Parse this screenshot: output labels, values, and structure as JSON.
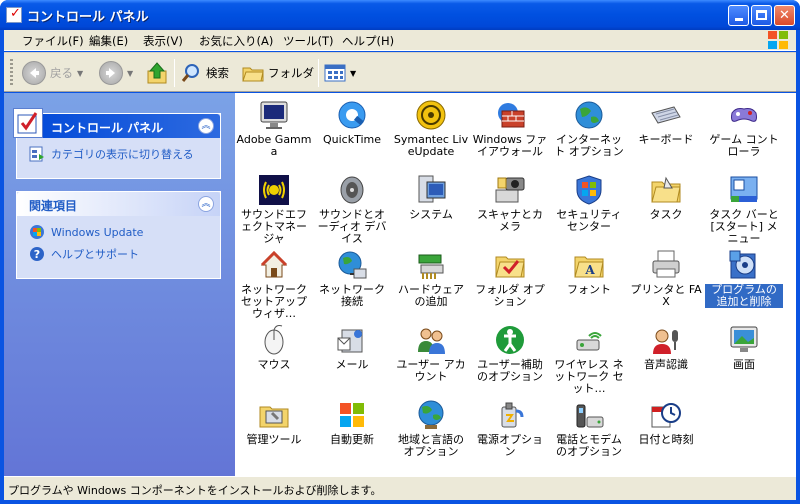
{
  "window": {
    "title": "コントロール パネル"
  },
  "menu": [
    "ファイル(F)",
    "編集(E)",
    "表示(V)",
    "お気に入り(A)",
    "ツール(T)",
    "ヘルプ(H)"
  ],
  "toolbar": {
    "back": "戻る",
    "search": "検索",
    "folders": "フォルダ"
  },
  "left": {
    "main_title": "コントロール パネル",
    "switch_view": "カテゴリの表示に切り替える",
    "related_title": "関連項目",
    "related": [
      "Windows Update",
      "ヘルプとサポート"
    ]
  },
  "icons": [
    {
      "name": "Adobe Gamma",
      "icon": "monitor-icon"
    },
    {
      "name": "QuickTime",
      "icon": "quicktime-icon"
    },
    {
      "name": "Symantec LiveUpdate",
      "icon": "liveupdate-icon"
    },
    {
      "name": "Windows ファイアウォール",
      "icon": "firewall-icon"
    },
    {
      "name": "インターネット オプション",
      "icon": "globe-icon"
    },
    {
      "name": "キーボード",
      "icon": "keyboard-icon"
    },
    {
      "name": "ゲーム コントローラ",
      "icon": "gamepad-icon"
    },
    {
      "name": "サウンドエフェクトマネージャ",
      "icon": "sound-effect-icon"
    },
    {
      "name": "サウンドとオーディオ デバイス",
      "icon": "speaker-icon"
    },
    {
      "name": "システム",
      "icon": "system-icon"
    },
    {
      "name": "スキャナとカメラ",
      "icon": "scanner-icon"
    },
    {
      "name": "セキュリティ センター",
      "icon": "shield-icon"
    },
    {
      "name": "タスク",
      "icon": "task-folder-icon"
    },
    {
      "name": "タスク バーと [スタート] メニュー",
      "icon": "taskbar-icon"
    },
    {
      "name": "ネットワーク セットアップ ウィザ…",
      "icon": "house-network-icon"
    },
    {
      "name": "ネットワーク接続",
      "icon": "network-globe-icon"
    },
    {
      "name": "ハードウェアの追加",
      "icon": "hardware-icon"
    },
    {
      "name": "フォルダ オプション",
      "icon": "folder-options-icon"
    },
    {
      "name": "フォント",
      "icon": "font-folder-icon"
    },
    {
      "name": "プリンタと FAX",
      "icon": "printer-icon"
    },
    {
      "name": "プログラムの追加と削除",
      "icon": "add-remove-icon"
    },
    {
      "name": "マウス",
      "icon": "mouse-icon"
    },
    {
      "name": "メール",
      "icon": "mail-icon"
    },
    {
      "name": "ユーザー アカウント",
      "icon": "users-icon"
    },
    {
      "name": "ユーザー補助のオプション",
      "icon": "accessibility-icon"
    },
    {
      "name": "ワイヤレス ネットワーク セット…",
      "icon": "wireless-icon"
    },
    {
      "name": "音声認識",
      "icon": "speech-icon"
    },
    {
      "name": "画面",
      "icon": "display-icon"
    },
    {
      "name": "管理ツール",
      "icon": "admin-tools-icon"
    },
    {
      "name": "自動更新",
      "icon": "windows-flag-icon"
    },
    {
      "name": "地域と言語のオプション",
      "icon": "region-globe-icon"
    },
    {
      "name": "電源オプション",
      "icon": "power-icon"
    },
    {
      "name": "電話とモデムのオプション",
      "icon": "phone-icon"
    },
    {
      "name": "日付と時刻",
      "icon": "clock-icon"
    }
  ],
  "selected_icon": "プログラムの追加と削除",
  "status": "プログラムや Windows コンポーネントをインストールおよび削除します。",
  "colors": {
    "title_blue": "#0050e0",
    "pane_blue": "#6375d6",
    "link_blue": "#215dc6",
    "selection": "#316ac5"
  }
}
